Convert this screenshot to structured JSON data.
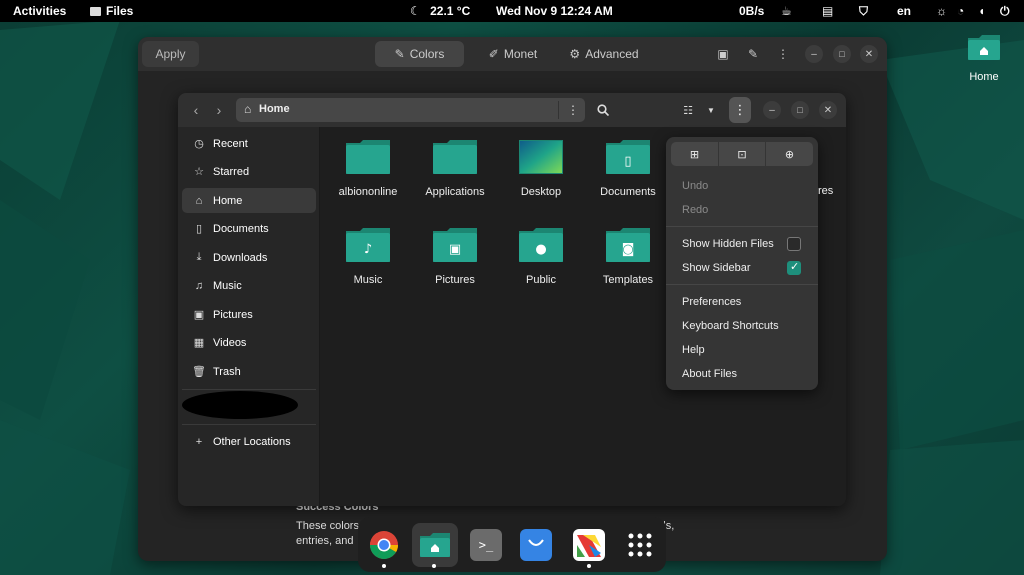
{
  "topbar": {
    "activities": "Activities",
    "app_name": "Files",
    "weather": "22.1 °C",
    "datetime": "Wed Nov 9  12:24 AM",
    "net_speed": "0B/s",
    "language": "en"
  },
  "desktop": {
    "home_label": "Home"
  },
  "bg_window": {
    "apply_label": "Apply",
    "tabs": [
      {
        "label": "Colors"
      },
      {
        "label": "Monet"
      },
      {
        "label": "Advanced"
      }
    ],
    "section_title": "Success Colors",
    "section_desc_1": "These colors are used across many different widgets, such as buttons, labels,",
    "section_desc_2": "entries, and"
  },
  "files_window": {
    "location": "Home",
    "sidebar": [
      {
        "label": "Recent",
        "icon": "clock-icon"
      },
      {
        "label": "Starred",
        "icon": "star-icon"
      },
      {
        "label": "Home",
        "icon": "home-icon"
      },
      {
        "label": "Documents",
        "icon": "document-icon"
      },
      {
        "label": "Downloads",
        "icon": "download-icon"
      },
      {
        "label": "Music",
        "icon": "music-icon"
      },
      {
        "label": "Pictures",
        "icon": "picture-icon"
      },
      {
        "label": "Videos",
        "icon": "video-icon"
      },
      {
        "label": "Trash",
        "icon": "trash-icon"
      }
    ],
    "other_locations": "Other Locations",
    "folders": [
      {
        "label": "albiononline",
        "glyph": ""
      },
      {
        "label": "Applications",
        "glyph": ""
      },
      {
        "label": "Desktop",
        "glyph": ""
      },
      {
        "label": "Documents",
        "glyph": "▯"
      },
      {
        "label": "Music",
        "glyph": "♪"
      },
      {
        "label": "Pictures",
        "glyph": "▣"
      },
      {
        "label": "Public",
        "glyph": "●"
      },
      {
        "label": "Templates",
        "glyph": "◙"
      }
    ],
    "partial_label": "res"
  },
  "menu": {
    "undo": "Undo",
    "redo": "Redo",
    "show_hidden": "Show Hidden Files",
    "show_hidden_checked": false,
    "show_sidebar": "Show Sidebar",
    "show_sidebar_checked": true,
    "preferences": "Preferences",
    "shortcuts": "Keyboard Shortcuts",
    "help": "Help",
    "about": "About Files"
  },
  "dock": [
    {
      "icon": "chrome-icon"
    },
    {
      "icon": "files-icon"
    },
    {
      "icon": "terminal-icon"
    },
    {
      "icon": "software-store-icon"
    },
    {
      "icon": "color-app-icon"
    },
    {
      "icon": "app-grid-icon"
    }
  ],
  "colors": {
    "accent": "#1e8f7c",
    "folder": "#26a58f",
    "folder_tab": "#1c8672"
  }
}
